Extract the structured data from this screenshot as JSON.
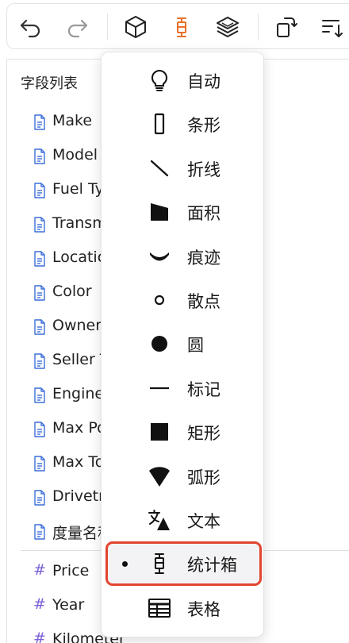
{
  "toolbar": {
    "buttons": [
      {
        "name": "undo",
        "icon": "undo-icon"
      },
      {
        "name": "redo",
        "icon": "redo-icon"
      },
      {
        "name": "3d",
        "icon": "cube-icon"
      },
      {
        "name": "mark-type",
        "icon": "boxplot-icon",
        "accent": "#e8702a"
      },
      {
        "name": "layers",
        "icon": "layers-icon"
      },
      {
        "name": "rotate",
        "icon": "rotate-icon"
      },
      {
        "name": "sort",
        "icon": "sort-icon"
      }
    ]
  },
  "panel": {
    "title": "字段列表",
    "dimensions": [
      {
        "label": "Make"
      },
      {
        "label": "Model"
      },
      {
        "label": "Fuel Ty"
      },
      {
        "label": "Transm"
      },
      {
        "label": "Locatic"
      },
      {
        "label": "Color"
      },
      {
        "label": "Owner"
      },
      {
        "label": "Seller T"
      },
      {
        "label": "Engine"
      },
      {
        "label": "Max Po"
      },
      {
        "label": "Max To"
      },
      {
        "label": "Drivetr"
      },
      {
        "label": "度量名称"
      }
    ],
    "measures": [
      {
        "label": "Price"
      },
      {
        "label": "Year"
      },
      {
        "label": "Kilometer"
      }
    ],
    "more_glyph": "⋮"
  },
  "menu": {
    "items": [
      {
        "label": "自动",
        "icon": "lightbulb-icon"
      },
      {
        "label": "条形",
        "icon": "bar-icon"
      },
      {
        "label": "折线",
        "icon": "line-icon"
      },
      {
        "label": "面积",
        "icon": "area-icon"
      },
      {
        "label": "痕迹",
        "icon": "trail-icon"
      },
      {
        "label": "散点",
        "icon": "point-icon"
      },
      {
        "label": "圆",
        "icon": "circle-icon"
      },
      {
        "label": "标记",
        "icon": "tick-icon"
      },
      {
        "label": "矩形",
        "icon": "rect-icon"
      },
      {
        "label": "弧形",
        "icon": "arc-icon"
      },
      {
        "label": "文本",
        "icon": "text-icon"
      },
      {
        "label": "统计箱",
        "icon": "boxplot-icon",
        "selected": true
      },
      {
        "label": "表格",
        "icon": "table-icon"
      }
    ],
    "highlight_color": "#e2442f"
  }
}
